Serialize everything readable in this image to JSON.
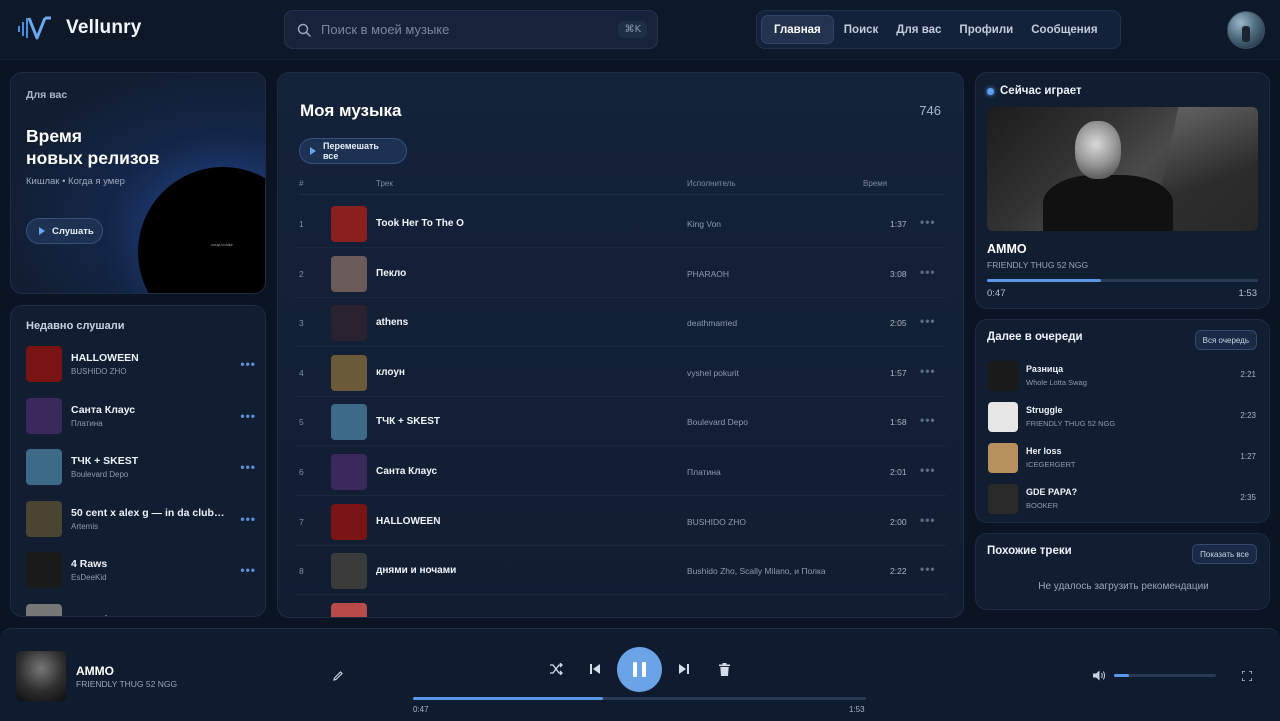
{
  "app": {
    "name": "Vellunry"
  },
  "search": {
    "placeholder": "Поиск в моей музыке",
    "shortcut": "⌘K"
  },
  "nav": [
    {
      "label": "Главная",
      "active": true
    },
    {
      "label": "Поиск",
      "active": false
    },
    {
      "label": "Для вас",
      "active": false
    },
    {
      "label": "Профили",
      "active": false
    },
    {
      "label": "Сообщения",
      "active": false
    }
  ],
  "hero": {
    "eyebrow": "Для вас",
    "title": "Время\nновых релизов",
    "subtitle": "Кишлак • Когда я умер",
    "button": "Слушать",
    "disc_label": "КОГДА Я УМЕР"
  },
  "recent": {
    "title": "Недавно слушали",
    "items": [
      {
        "name": "HALLOWEEN",
        "artist": "BUSHIDO ZHO",
        "color": "#7a1414"
      },
      {
        "name": "Санта Клаус",
        "artist": "Платина",
        "color": "#3a2a5c"
      },
      {
        "name": "ТЧК + SKEST",
        "artist": "Boulevard Depo",
        "color": "#3d6a86"
      },
      {
        "name": "50 cent x alex g — in da club f...",
        "artist": "Artemis",
        "color": "#4a4530"
      },
      {
        "name": "4 Raws",
        "artist": "EsDeeKid",
        "color": "#1a1a1a"
      },
      {
        "name": "Tapped In",
        "artist": "",
        "color": "#777777"
      }
    ]
  },
  "library": {
    "title": "Моя музыка",
    "count": "746",
    "shuffle_button": "Перемешать все",
    "headers": {
      "num": "#",
      "track": "Трек",
      "artist": "Исполнитель",
      "time": "Время"
    },
    "tracks": [
      {
        "num": "1",
        "name": "Took Her To The O",
        "artist": "King Von",
        "time": "1:37",
        "color": "#8a2020"
      },
      {
        "num": "2",
        "name": "Пекло",
        "artist": "PHARAOH",
        "time": "3:08",
        "color": "#6a5a5a"
      },
      {
        "num": "3",
        "name": "athens",
        "artist": "deathmarried",
        "time": "2:05",
        "color": "#2a2230"
      },
      {
        "num": "4",
        "name": "клоун",
        "artist": "vyshel pokurit",
        "time": "1:57",
        "color": "#6b5a3a"
      },
      {
        "num": "5",
        "name": "ТЧК + SKEST",
        "artist": "Boulevard Depo",
        "time": "1:58",
        "color": "#3d6a86"
      },
      {
        "num": "6",
        "name": "Санта Клаус",
        "artist": "Платина",
        "time": "2:01",
        "color": "#3a2a5c"
      },
      {
        "num": "7",
        "name": "HALLOWEEN",
        "artist": "BUSHIDO ZHO",
        "time": "2:00",
        "color": "#7a1414"
      },
      {
        "num": "8",
        "name": "днями и ночами",
        "artist": "Bushido Zho, Scally Milano, и Полка",
        "time": "2:22",
        "color": "#3b3b3b"
      }
    ],
    "partial_color": "#b84a4a"
  },
  "now_playing": {
    "heading": "Сейчас играет",
    "title": "AMMO",
    "artist": "FRIENDLY THUG 52 NGG",
    "current": "0:47",
    "duration": "1:53",
    "progress": 0.42
  },
  "queue": {
    "title": "Далее в очереди",
    "button": "Вся очередь",
    "items": [
      {
        "name": "Разница",
        "artist": "Whole Lotta Swag",
        "time": "2:21",
        "color": "#1a1a1a"
      },
      {
        "name": "Struggle",
        "artist": "FRIENDLY THUG 52 NGG",
        "time": "2:23",
        "color": "#e6e6e6"
      },
      {
        "name": "Her loss",
        "artist": "ICEGERGERT",
        "time": "1:27",
        "color": "#b89060"
      },
      {
        "name": "GDE PAPA?",
        "artist": "BOOKER",
        "time": "2:35",
        "color": "#2a2a2a"
      }
    ]
  },
  "similar": {
    "title": "Похожие треки",
    "button": "Показать все",
    "empty": "Не удалось загрузить рекомендации"
  },
  "player": {
    "title": "AMMO",
    "artist": "FRIENDLY THUG 52 NGG",
    "current": "0:47",
    "duration": "1:53",
    "progress": 0.42,
    "volume": 0.15
  }
}
